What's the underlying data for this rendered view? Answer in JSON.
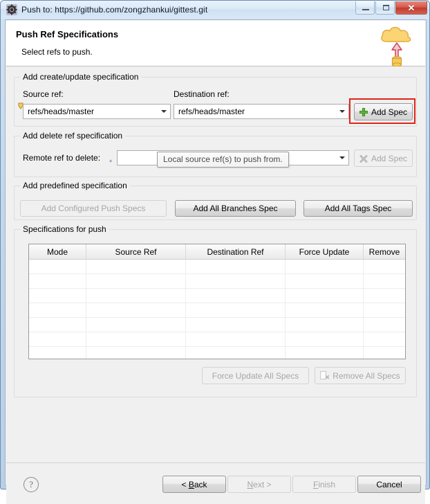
{
  "window": {
    "title": "Push to: https://github.com/zongzhankui/gittest.git",
    "icon": "gear-icon",
    "controls": {
      "minimize": "minimize-button",
      "maximize": "maximize-button",
      "close_label": "✕"
    }
  },
  "header": {
    "title": "Push Ref Specifications",
    "subtitle": "Select refs to push.",
    "icon": "cloud-upload-icon"
  },
  "groups": {
    "create_update": {
      "legend": "Add create/update specification",
      "source_label": "Source ref:",
      "source_value": "refs/heads/master",
      "destination_label": "Destination ref:",
      "destination_value": "refs/heads/master",
      "add_spec_label": "Add Spec",
      "add_spec_icon": "green-plus-icon",
      "highlighted": true
    },
    "delete_ref": {
      "legend": "Add delete ref specification",
      "remote_label": "Remote ref to delete:",
      "remote_value": "",
      "required_marker": "*",
      "add_spec_label": "Add Spec",
      "add_spec_icon": "gray-x-icon",
      "add_spec_disabled": true
    },
    "predefined": {
      "legend": "Add predefined specification",
      "buttons": [
        {
          "label": "Add Configured Push Specs",
          "disabled": true
        },
        {
          "label": "Add All Branches Spec",
          "disabled": false
        },
        {
          "label": "Add All Tags Spec",
          "disabled": false
        }
      ]
    },
    "specifications": {
      "legend": "Specifications for push",
      "columns": [
        "Mode",
        "Source Ref",
        "Destination Ref",
        "Force Update",
        "Remove"
      ],
      "rows": [],
      "empty_row_count": 7,
      "force_update_all_label": "Force Update All Specs",
      "force_update_all_disabled": true,
      "remove_all_label": "Remove All Specs",
      "remove_all_icon": "document-remove-icon",
      "remove_all_disabled": true
    }
  },
  "tooltip": {
    "text": "Local source ref(s) to push from."
  },
  "footer": {
    "help_icon": "question-mark-icon",
    "buttons": [
      {
        "name": "back",
        "pre": "< ",
        "accel": "B",
        "post": "ack",
        "disabled": false
      },
      {
        "name": "next",
        "pre": "",
        "accel": "N",
        "post": "ext >",
        "disabled": true
      },
      {
        "name": "finish",
        "pre": "",
        "accel": "F",
        "post": "inish",
        "disabled": true
      },
      {
        "name": "cancel",
        "pre": "",
        "accel": "",
        "post": "Cancel",
        "disabled": false
      }
    ]
  },
  "colors": {
    "highlight_red": "#e02418",
    "accent_green": "#66bb33",
    "titlebar_blue": "#cfe0f2",
    "dialog_bg": "#f0f0f0"
  }
}
